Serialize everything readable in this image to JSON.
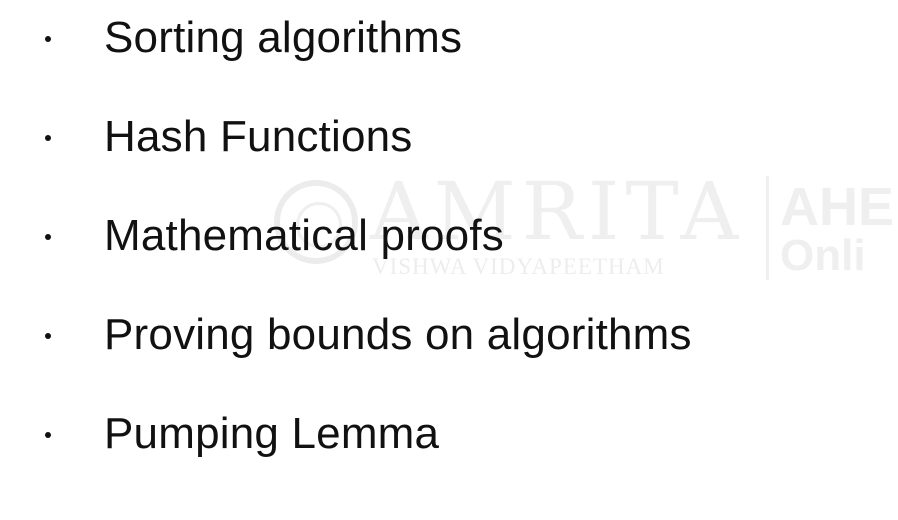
{
  "slide": {
    "bullets": [
      "Sorting algorithms",
      "Hash Functions",
      "Mathematical proofs",
      "Proving bounds on algorithms",
      "Pumping Lemma"
    ]
  },
  "watermark": {
    "main": "AMRITA",
    "sub": "VISHWA VIDYAPEETHAM",
    "right_top": "AHE",
    "right_bottom": "Onli",
    "seal_icon": "amrita-seal-icon"
  },
  "colors": {
    "text": "#111111",
    "watermark": "#efefef",
    "background": "#ffffff"
  }
}
